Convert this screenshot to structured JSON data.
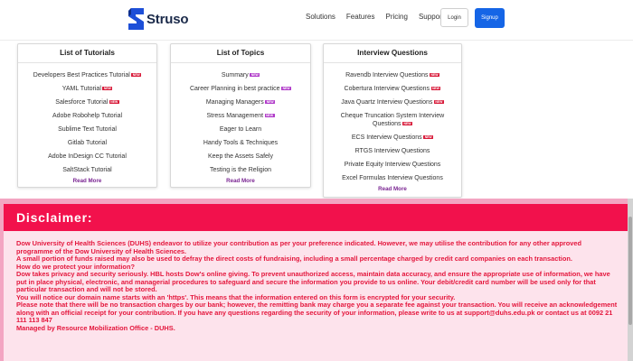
{
  "header": {
    "brand": "Struso",
    "nav": [
      "Solutions",
      "Features",
      "Pricing",
      "Support"
    ],
    "login_label": "Login",
    "signup_label": "Signup"
  },
  "cards": [
    {
      "title": "List of Tutorials",
      "items": [
        {
          "label": "Developers Best Practices Tutorial",
          "badge": "NEW"
        },
        {
          "label": "YAML Tutorial",
          "badge": "NEW"
        },
        {
          "label": "Salesforce Tutorial",
          "badge": "NEW"
        },
        {
          "label": "Adobe Robohelp Tutorial",
          "badge": ""
        },
        {
          "label": "Sublime Text Tutorial",
          "badge": ""
        },
        {
          "label": "Gitlab Tutorial",
          "badge": ""
        },
        {
          "label": "Adobe InDesign CC Tutorial",
          "badge": ""
        },
        {
          "label": "SaltStack Tutorial",
          "badge": ""
        }
      ],
      "read_more": "Read More"
    },
    {
      "title": "List of Topics",
      "items": [
        {
          "label": "Summary",
          "badge": "NEW"
        },
        {
          "label": "Career Planning in best practice",
          "badge": "NEW"
        },
        {
          "label": "Managing Managers",
          "badge": "NEW"
        },
        {
          "label": "Stress Management",
          "badge": "NEW"
        },
        {
          "label": "Eager to Learn",
          "badge": ""
        },
        {
          "label": "Handy Tools & Techniques",
          "badge": ""
        },
        {
          "label": "Keep the Assets Safely",
          "badge": ""
        },
        {
          "label": "Testing is the Religion",
          "badge": ""
        }
      ],
      "read_more": "Read More"
    },
    {
      "title": "Interview Questions",
      "items": [
        {
          "label": "Ravendb Interview Questions",
          "badge": "NEW"
        },
        {
          "label": "Cobertura Interview Questions",
          "badge": "NEW"
        },
        {
          "label": "Java Quartz Interview Questions",
          "badge": "NEW"
        },
        {
          "label": "Cheque Truncation System Interview Questions",
          "badge": "NEW"
        },
        {
          "label": "ECS Interview Questions",
          "badge": "NEW"
        },
        {
          "label": "RTGS Interview Questions",
          "badge": ""
        },
        {
          "label": "Private Equity Interview Questions",
          "badge": ""
        },
        {
          "label": "Excel Formulas Interview Questions",
          "badge": ""
        }
      ],
      "read_more": "Read More"
    }
  ],
  "disclaimer": {
    "title": "Disclaimer:",
    "paragraphs": [
      "Dow University of Health Sciences (DUHS) endeavor to utilize your contribution as per your preference indicated. However, we may utilise the contribution for any other approved programme of the Dow University of Health Sciences.",
      "A small portion of funds raised may also be used to defray the direct costs of fundraising, including a small percentage charged by credit card companies on each transaction.",
      "How do we protect your information?",
      "Dow takes privacy and security seriously. HBL hosts Dow's online giving. To prevent unauthorized access, maintain data accuracy, and ensure the appropriate use of information, we have put in place physical, electronic, and managerial procedures to safeguard and secure the information you provide to us online. Your debit/credit card number will be used only for that particular transaction and will not be stored.",
      "You will notice our domain name starts with an 'https'. This means that the information entered on this form is encrypted for your security.",
      "Please note that there will be no transaction charges by our bank; however, the remitting bank may charge you a separate fee against your transaction. You will receive an acknowledgement along with an official receipt for your contribution. If you have any questions regarding the security of your information, please write to us at support@duhs.edu.pk or contact us at 0092 21 111 113 847",
      "Managed by Resource Mobilization Office - DUHS."
    ]
  },
  "colors": {
    "accent_blue": "#1565e6",
    "disclaimer_header": "#f2114c",
    "disclaimer_text": "#e4173d",
    "backdrop_pink": "#f3a5c2",
    "read_more": "#7a2592"
  },
  "icons": {
    "brand_logo": "struso-s-logo-icon",
    "badge": "new-badge-icon"
  }
}
